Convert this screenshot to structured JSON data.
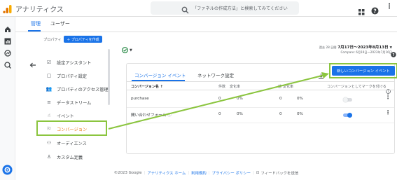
{
  "app": {
    "title": "アナリティクス"
  },
  "search": {
    "placeholder": "「ファネルの作成方法」と検索してみてください"
  },
  "tabs": [
    {
      "label": "管理"
    },
    {
      "label": "ユーザー"
    }
  ],
  "property": {
    "label": "プロパティ",
    "create_label": "＋ プロパティを作成"
  },
  "nav": [
    {
      "label": "設定アシスタント",
      "icon": "checklist"
    },
    {
      "label": "プロパティ設定",
      "icon": "settings-box"
    },
    {
      "label": "プロパティのアクセス管理",
      "icon": "people"
    },
    {
      "label": "データストリーム",
      "icon": "streams"
    },
    {
      "label": "イベント",
      "icon": "touch"
    },
    {
      "label": "コンバージョン",
      "icon": "flag"
    },
    {
      "label": "オーディエンス",
      "icon": "audience"
    },
    {
      "label": "カスタム定義",
      "icon": "custom"
    }
  ],
  "date_range": {
    "prefix": "過去 28 日間",
    "range": "7月17日〜2023年8月13日",
    "compare": "Compare: 6月19日〜2023年7月16日"
  },
  "conversion_tabs": [
    {
      "label": "コンバージョン イベント"
    },
    {
      "label": "ネットワーク設定"
    }
  ],
  "new_button": {
    "label": "新しいコンバージョン イベント"
  },
  "table": {
    "headers": {
      "name": "コンバージョン名 ↑",
      "count": "件数",
      "change": "変化率",
      "value": "値",
      "value_change": "変化率",
      "mark": "コンバージョンとしてマークを付ける"
    },
    "rows": [
      {
        "name": "purchase",
        "count": "0",
        "change": "0%",
        "value": "0",
        "value_change": "0%",
        "toggle": false
      },
      {
        "name": "間い合わせフォーム",
        "count": "0",
        "change": "0%",
        "value": "0",
        "value_change": "0%",
        "toggle": true
      }
    ]
  },
  "footer": {
    "copyright": "©2023 Google",
    "links": [
      "アナリティクス ホーム",
      "利用規約",
      "プライバシー ポリシー"
    ],
    "feedback": "フィードバックを送信"
  },
  "colors": {
    "accent": "#1a73e8",
    "highlight": "#8bc53f",
    "logo_orange": "#f9ab00",
    "logo_dark": "#e37400"
  }
}
